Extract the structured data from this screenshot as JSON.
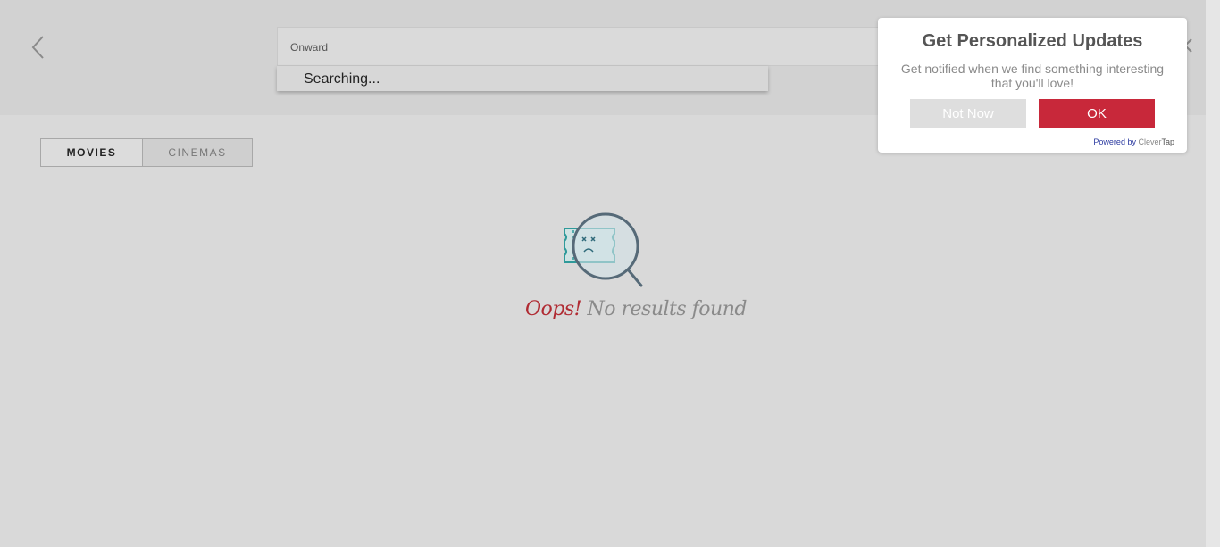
{
  "header": {
    "search": {
      "value": "Onward"
    },
    "suggestions": {
      "status": "Searching..."
    }
  },
  "tabs": [
    {
      "label": "MOVIES",
      "active": true
    },
    {
      "label": "CINEMAS",
      "active": false
    }
  ],
  "empty_state": {
    "oops": "Oops!",
    "message": "No results found"
  },
  "popup": {
    "title": "Get Personalized Updates",
    "body": "Get notified when we find something interesting that you'll love!",
    "not_now_label": "Not Now",
    "ok_label": "OK",
    "powered_by": "Powered by",
    "brand_part1": "Clever",
    "brand_part2": "Tap"
  },
  "colors": {
    "accent": "#c8283a",
    "background": "#d9d9d9",
    "header_bg": "#d2d2d2"
  },
  "icons": {
    "back": "chevron-left-icon",
    "close": "close-icon",
    "empty": "ticket-magnifier-icon"
  }
}
